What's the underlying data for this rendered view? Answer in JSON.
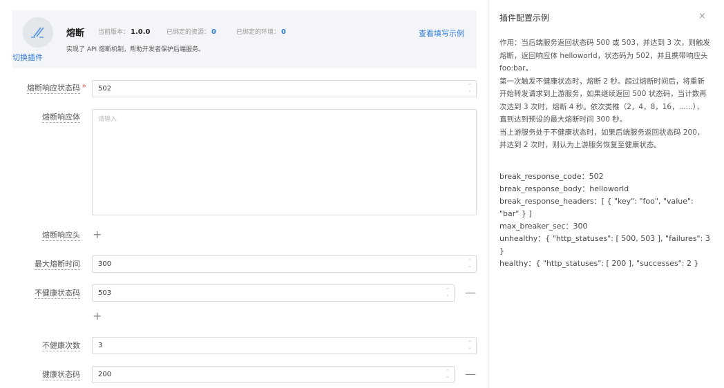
{
  "header": {
    "switch_label": "切换插件",
    "plugin_name": "熔断",
    "version_label": "当前版本：",
    "version": "1.0.0",
    "resources_label": "已绑定的资源：",
    "resources": "0",
    "envs_label": "已绑定的环境：",
    "envs": "0",
    "description": "实现了 API 熔断机制，帮助开发者保护后端服务。",
    "example_link": "查看填写示例",
    "icon": "plugin-icon"
  },
  "form": {
    "break_code": {
      "label": "熔断响应状态码",
      "required": "*",
      "value": "502"
    },
    "break_body": {
      "label": "熔断响应体",
      "placeholder": "请输入"
    },
    "break_headers": {
      "label": "熔断响应头",
      "add": "+"
    },
    "max_time": {
      "label": "最大熔断时间",
      "value": "300"
    },
    "unhealthy_codes": {
      "label": "不健康状态码",
      "value": "503",
      "remove": "—",
      "add": "+"
    },
    "unhealthy_count": {
      "label": "不健康次数",
      "value": "3"
    },
    "healthy_codes": {
      "label": "健康状态码",
      "value": "200",
      "remove": "—"
    }
  },
  "panel": {
    "title": "插件配置示例",
    "close": "×",
    "description": [
      "作用：当后端服务返回状态码 500 或 503，并达到 3 次，则触发熔断，返回响应体 helloworld，状态码为 502，并且携带响应头 foo:bar。",
      "第一次触发不健康状态时，熔断 2 秒。超过熔断时间后，将重新开始转发请求到上游服务，如果继续返回 500 状态码，当计数再次达到 3 次时，熔断 4 秒。依次类推（2，4，8，16，......），直到达到预设的最大熔断时间 300 秒。",
      "当上游服务处于不健康状态时，如果后端服务返回状态码 200，并达到 2 次时，则认为上游服务恢复至健康状态。"
    ],
    "config": [
      "break_response_code：502",
      "break_response_body：helloworld",
      "break_response_headers：[ { \"key\": \"foo\", \"value\": \"bar\" } ]",
      "max_breaker_sec：300",
      "unhealthy：{ \"http_statuses\": [ 500, 503 ], \"failures\": 3 }",
      "healthy：{ \"http_statuses\": [ 200 ], \"successes\": 2 }"
    ]
  }
}
